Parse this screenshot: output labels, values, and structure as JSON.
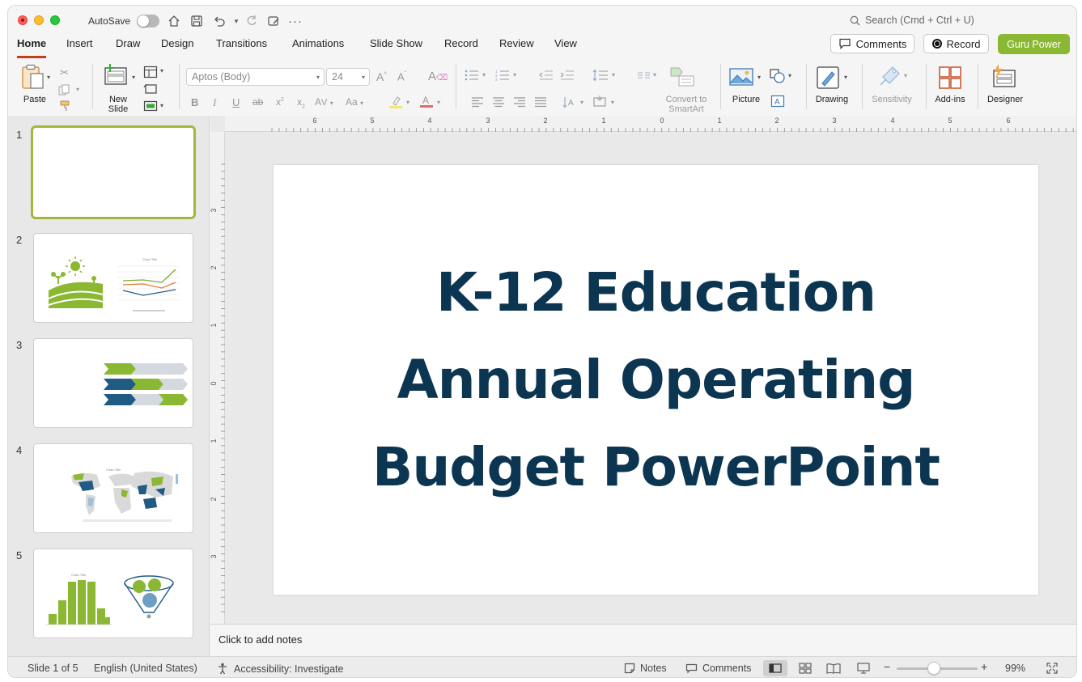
{
  "titlebar": {
    "autosave_label": "AutoSave",
    "search_placeholder": "Search (Cmd + Ctrl + U)"
  },
  "tabs": [
    "Home",
    "Insert",
    "Draw",
    "Design",
    "Transitions",
    "Animations",
    "Slide Show",
    "Record",
    "Review",
    "View"
  ],
  "active_tab": "Home",
  "header_buttons": {
    "comments": "Comments",
    "record": "Record",
    "guru": "Guru Power"
  },
  "ribbon": {
    "paste": "Paste",
    "new_slide": [
      "New",
      "Slide"
    ],
    "font_name": "Aptos (Body)",
    "font_size": "24",
    "convert_smartart": [
      "Convert to",
      "SmartArt"
    ],
    "picture": "Picture",
    "drawing": "Drawing",
    "sensitivity": "Sensitivity",
    "addins": "Add-ins",
    "designer": "Designer"
  },
  "slides": {
    "numbers": [
      "1",
      "2",
      "3",
      "4",
      "5"
    ],
    "selected": 1,
    "thumb2_chart_title": "Chart Title",
    "thumb4_chart_title": "Chart Title",
    "thumb5_chart_title": "Chart Title"
  },
  "ruler": {
    "h_labels": [
      "6",
      "5",
      "4",
      "3",
      "2",
      "1",
      "0",
      "1",
      "2",
      "3",
      "4",
      "5",
      "6"
    ],
    "v_labels": [
      "3",
      "2",
      "1",
      "0",
      "1",
      "2",
      "3"
    ]
  },
  "slide": {
    "title_lines": [
      "K-12 Education",
      "Annual Operating",
      "Budget PowerPoint"
    ]
  },
  "notes": {
    "placeholder": "Click to add notes"
  },
  "status": {
    "slide_info": "Slide 1 of 5",
    "language": "English (United States)",
    "accessibility": "Accessibility: Investigate",
    "notes": "Notes",
    "comments": "Comments",
    "zoom": "99%"
  },
  "colors": {
    "accent_green": "#8ab833",
    "title_navy": "#0c3551",
    "active_tab_underline": "#c43e1c",
    "thumb_selected_border": "#a6b53a"
  }
}
